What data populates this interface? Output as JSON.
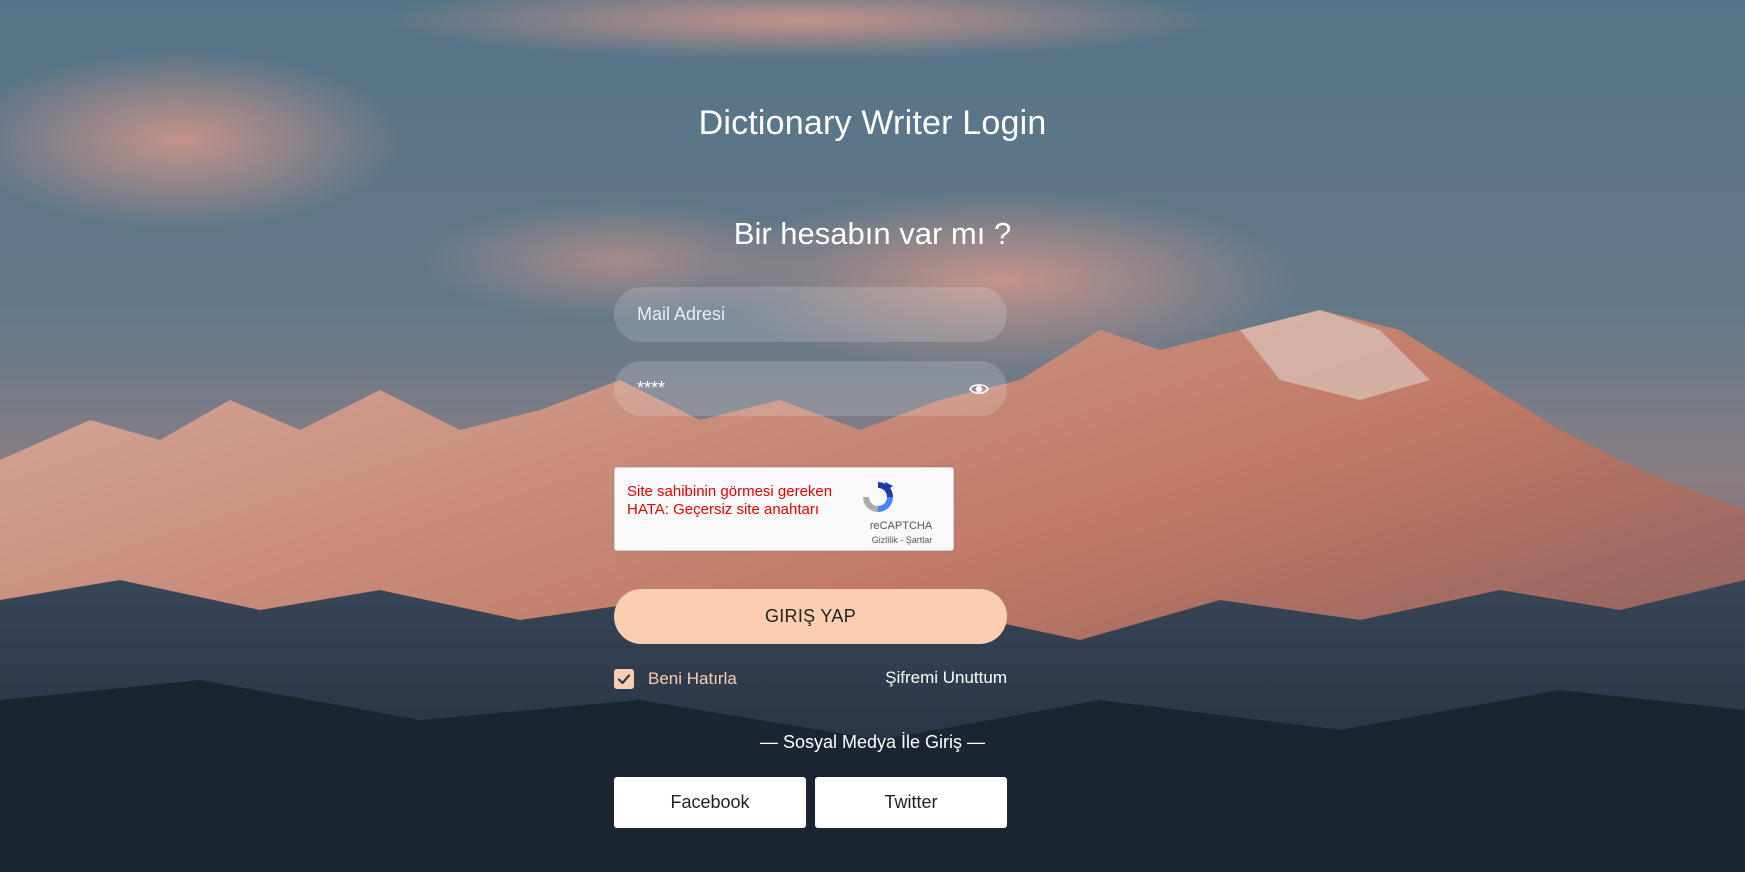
{
  "header": {
    "title": "Dictionary Writer Login",
    "subtitle": "Bir hesabın var mı ?"
  },
  "form": {
    "email_placeholder": "Mail Adresi",
    "password_value": "****",
    "submit_label": "GIRIŞ YAP",
    "remember_label": "Beni Hatırla",
    "remember_checked": true,
    "forgot_label": "Şifremi Unuttum"
  },
  "captcha": {
    "error_text": "Site sahibinin görmesi gereken HATA: Geçersiz site anahtarı",
    "brand": "reCAPTCHA",
    "privacy_label": "Gizlilik",
    "separator": "-",
    "terms_label": "Şartlar"
  },
  "social": {
    "label": "— Sosyal Medya İle Giriş —",
    "facebook_label": "Facebook",
    "twitter_label": "Twitter"
  },
  "colors": {
    "accent": "#fbceb1",
    "captcha_error": "#e00000"
  },
  "icons": {
    "password_toggle": "eye-icon",
    "remember": "check-icon",
    "captcha_logo": "recaptcha-logo-icon"
  }
}
